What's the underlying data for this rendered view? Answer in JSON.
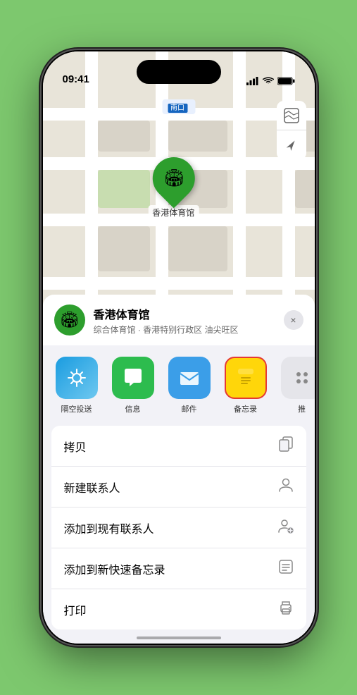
{
  "status": {
    "time": "09:41",
    "location_arrow": "▲"
  },
  "map": {
    "location_label": "南口",
    "stadium_name": "香港体育馆",
    "controls": {
      "map_icon": "🗺",
      "location_icon": "➤"
    }
  },
  "venue_card": {
    "name": "香港体育馆",
    "description": "综合体育馆 · 香港特别行政区 油尖旺区",
    "close_label": "×"
  },
  "share_row": {
    "items": [
      {
        "label": "隔空投送",
        "type": "airdrop"
      },
      {
        "label": "信息",
        "type": "messages"
      },
      {
        "label": "邮件",
        "type": "mail"
      },
      {
        "label": "备忘录",
        "type": "notes"
      }
    ]
  },
  "actions": [
    {
      "text": "拷贝",
      "icon": "copy"
    },
    {
      "text": "新建联系人",
      "icon": "person"
    },
    {
      "text": "添加到现有联系人",
      "icon": "person-add"
    },
    {
      "text": "添加到新快速备忘录",
      "icon": "note"
    },
    {
      "text": "打印",
      "icon": "print"
    }
  ]
}
